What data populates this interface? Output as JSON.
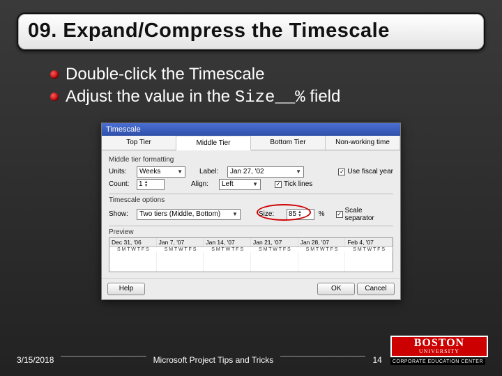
{
  "title": "09. Expand/Compress the Timescale",
  "bullets": {
    "b1": "Double-click the Timescale",
    "b2_pre": "Adjust the value in the ",
    "b2_code": "Size__%",
    "b2_post": " field"
  },
  "dialog": {
    "title": "Timescale",
    "tabs": {
      "t1": "Top Tier",
      "t2": "Middle Tier",
      "t3": "Bottom Tier",
      "t4": "Non-working time"
    },
    "group1": "Middle tier formatting",
    "units_lbl": "Units:",
    "units_val": "Weeks",
    "label_lbl": "Label:",
    "label_val": "Jan 27, '02",
    "fiscal_lbl": "Use fiscal year",
    "count_lbl": "Count:",
    "count_val": "1",
    "align_lbl": "Align:",
    "align_val": "Left",
    "tick_lbl": "Tick lines",
    "group2": "Timescale options",
    "show_lbl": "Show:",
    "show_val": "Two tiers (Middle, Bottom)",
    "size_lbl": "Size:",
    "size_val": "85",
    "size_pct": "%",
    "sep_lbl": "Scale separator",
    "preview_lbl": "Preview",
    "headers": [
      "Dec 31, '06",
      "Jan 7, '07",
      "Jan 14, '07",
      "Jan 21, '07",
      "Jan 28, '07",
      "Feb 4, '07"
    ],
    "day_pat": "S M T W T F S",
    "help": "Help",
    "ok": "OK",
    "cancel": "Cancel"
  },
  "footer": {
    "date": "3/15/2018",
    "center": "Microsoft Project Tips and Tricks",
    "page": "14",
    "logo_top": "BOSTON",
    "logo_sub": "UNIVERSITY",
    "logo_tag": "CORPORATE EDUCATION CENTER"
  }
}
